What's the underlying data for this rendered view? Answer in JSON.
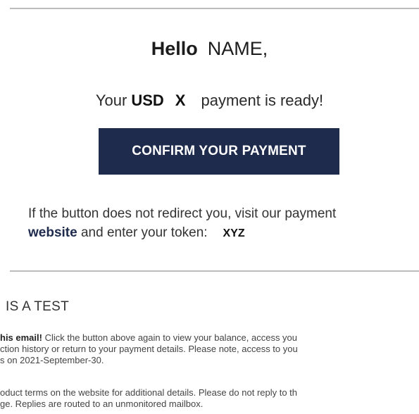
{
  "greeting": {
    "hello": "Hello",
    "name": "NAME,"
  },
  "payment": {
    "prefix": "Your",
    "currency": "USD",
    "amount": "X",
    "suffix": "payment is ready!"
  },
  "confirm_button": {
    "label": "CONFIRM YOUR PAYMENT"
  },
  "redirect": {
    "line1": "If the button does not redirect you, visit our payment",
    "link": "website",
    "line2_rest": " and enter your token:",
    "token": "XYZ"
  },
  "test_section": {
    "heading": "IS A TEST",
    "para1_bold": "his email!",
    "para1_line1_rest": " Click the button above again to view your balance, access you",
    "para1_line2": "ction history or return to your payment details. Please note, access to you",
    "para1_line3": "s on 2021-September-30.",
    "para2_line1": "oduct terms on the website for additional details. Please do not reply to th",
    "para2_line2": "ge. Replies are routed to an unmonitored mailbox."
  },
  "colors": {
    "button_bg": "#1e2b4d",
    "rule": "#bcbcbc"
  }
}
